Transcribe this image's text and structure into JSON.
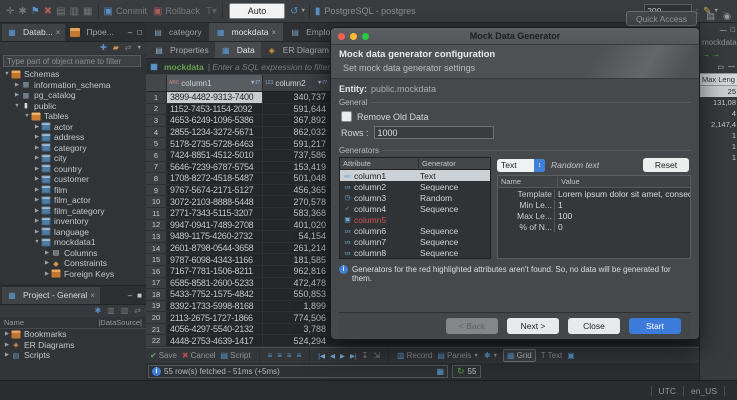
{
  "toolbar": {
    "commit": "Commit",
    "rollback": "Rollback",
    "auto": "Auto",
    "connection": "PostgreSQL - postgres",
    "fetch_size": "200",
    "quick_access": "Quick Access"
  },
  "navigator": {
    "tab_database": "Datab...",
    "tab_project_explorer": "Проe...",
    "filter_placeholder": "Type part of object name to filter",
    "tree": [
      {
        "arrow": "▼",
        "icon": "schemas",
        "label": "Schemas",
        "level": 0
      },
      {
        "arrow": "▶",
        "icon": "schema",
        "label": "information_schema",
        "level": 1
      },
      {
        "arrow": "▶",
        "icon": "schema",
        "label": "pg_catalog",
        "level": 1
      },
      {
        "arrow": "▼",
        "icon": "db",
        "label": "public",
        "level": 1
      },
      {
        "arrow": "▼",
        "icon": "tables",
        "label": "Tables",
        "level": 2
      },
      {
        "arrow": "▶",
        "icon": "table",
        "label": "actor",
        "level": 3
      },
      {
        "arrow": "▶",
        "icon": "table",
        "label": "address",
        "level": 3
      },
      {
        "arrow": "▶",
        "icon": "table",
        "label": "category",
        "level": 3
      },
      {
        "arrow": "▶",
        "icon": "table",
        "label": "city",
        "level": 3
      },
      {
        "arrow": "▶",
        "icon": "table",
        "label": "country",
        "level": 3
      },
      {
        "arrow": "▶",
        "icon": "table",
        "label": "customer",
        "level": 3
      },
      {
        "arrow": "▶",
        "icon": "table",
        "label": "film",
        "level": 3
      },
      {
        "arrow": "▶",
        "icon": "table",
        "label": "film_actor",
        "level": 3
      },
      {
        "arrow": "▶",
        "icon": "table",
        "label": "film_category",
        "level": 3
      },
      {
        "arrow": "▶",
        "icon": "table",
        "label": "inventory",
        "level": 3
      },
      {
        "arrow": "▶",
        "icon": "table",
        "label": "language",
        "level": 3
      },
      {
        "arrow": "▼",
        "icon": "table",
        "label": "mockdata1",
        "level": 3
      },
      {
        "arrow": "▶",
        "icon": "columns",
        "label": "Columns",
        "level": 4
      },
      {
        "arrow": "▶",
        "icon": "constraints",
        "label": "Constraints",
        "level": 4
      },
      {
        "arrow": "▶",
        "icon": "folder",
        "label": "Foreign Keys",
        "level": 4
      }
    ]
  },
  "project_panel": {
    "tab": "Project - General",
    "col_name": "Name",
    "col_datasource": "|DataSource|",
    "items": [
      {
        "arrow": "▶",
        "icon": "folder",
        "label": "Bookmarks"
      },
      {
        "arrow": "▶",
        "icon": "er",
        "label": "ER Diagrams"
      },
      {
        "arrow": "▶",
        "icon": "scripts",
        "label": "Scripts"
      }
    ]
  },
  "editor": {
    "tabs": [
      {
        "icon": "sql",
        "label": "category",
        "active": false,
        "closable": false
      },
      {
        "icon": "grid",
        "label": "mockdata",
        "active": true,
        "closable": true
      },
      {
        "icon": "sql",
        "label": "Employee",
        "active": false,
        "closable": false
      }
    ],
    "subtabs": [
      {
        "icon": "props",
        "label": "Properties",
        "active": false
      },
      {
        "icon": "data",
        "label": "Data",
        "active": true
      },
      {
        "icon": "er",
        "label": "ER Diagram",
        "active": false
      }
    ],
    "filter_entity": "mockdata",
    "filter_placeholder": "Enter a SQL expression to filter resu",
    "grid": {
      "col1": "column1",
      "col2": "column2",
      "col1_type": "ABC",
      "col2_type": "123",
      "rows": [
        {
          "c1": "3899-4482-9313-7400",
          "c2": "340,737",
          "sel": true
        },
        {
          "c1": "1152-7453-1154-2092",
          "c2": "591,644"
        },
        {
          "c1": "4653-6249-1096-5386",
          "c2": "367,892"
        },
        {
          "c1": "2855-1234-3272-5671",
          "c2": "862,032"
        },
        {
          "c1": "5178-2735-5728-6463",
          "c2": "591,217"
        },
        {
          "c1": "7424-8851-4512-5010",
          "c2": "737,586"
        },
        {
          "c1": "5646-7239-6787-5754",
          "c2": "153,419"
        },
        {
          "c1": "1708-8272-4518-5487",
          "c2": "501,048"
        },
        {
          "c1": "9767-5674-2171-5127",
          "c2": "456,365"
        },
        {
          "c1": "3072-2103-8888-5448",
          "c2": "270,578"
        },
        {
          "c1": "2771-7343-5115-3207",
          "c2": "583,368"
        },
        {
          "c1": "9947-0941-7489-2708",
          "c2": "401,020"
        },
        {
          "c1": "9489-1175-4260-2732",
          "c2": "54,154"
        },
        {
          "c1": "2601-8798-0544-3658",
          "c2": "261,214"
        },
        {
          "c1": "9787-6098-4343-1166",
          "c2": "181,585"
        },
        {
          "c1": "7167-7781-1506-8211",
          "c2": "962,816"
        },
        {
          "c1": "6585-8581-2600-5233",
          "c2": "472,478"
        },
        {
          "c1": "5433-7752-1575-4842",
          "c2": "550,853"
        },
        {
          "c1": "8392-1733-5998-8168",
          "c2": "1,899"
        },
        {
          "c1": "2113-2675-1727-1866",
          "c2": "774,506"
        },
        {
          "c1": "4056-4297-5540-2132",
          "c2": "3,788"
        },
        {
          "c1": "4448-2753-4639-1417",
          "c2": "524,294"
        }
      ]
    },
    "toolbar": {
      "save": "Save",
      "cancel": "Cancel",
      "script": "Script",
      "record": "Record",
      "panels": "Panels",
      "grid": "Grid",
      "text": "Text"
    },
    "status_message": "55 row(s) fetched - 51ms (+5ms)",
    "row_count": "55"
  },
  "dialog": {
    "title": "Mock Data Generator",
    "header_title": "Mock data generator configuration",
    "header_subtitle": "Set mock data generator settings",
    "entity_label": "Entity:",
    "entity_value": "public.mockdata",
    "general_label": "General",
    "remove_old_label": "Remove Old Data",
    "rows_label": "Rows :",
    "rows_value": "1000",
    "generators_label": "Generators",
    "attr_header": "Attribute",
    "gen_header": "Generator",
    "attributes": [
      {
        "name": "column1",
        "generator": "Text",
        "icon": "abc",
        "selected": true
      },
      {
        "name": "column2",
        "generator": "Sequence",
        "icon": "123"
      },
      {
        "name": "column3",
        "generator": "Random",
        "icon": "clock"
      },
      {
        "name": "column4",
        "generator": "Sequence",
        "icon": "check"
      },
      {
        "name": "column5",
        "generator": "",
        "icon": "box",
        "missing": true
      },
      {
        "name": "column6",
        "generator": "Sequence",
        "icon": "123"
      },
      {
        "name": "column7",
        "generator": "Sequence",
        "icon": "123"
      },
      {
        "name": "column8",
        "generator": "Sequence",
        "icon": "123"
      }
    ],
    "generator_select": "Text",
    "generator_desc": "Random text",
    "reset_label": "Reset",
    "prop_name_header": "Name",
    "prop_value_header": "Value",
    "props": [
      {
        "name": "Template",
        "value": "Lorem ipsum dolor sit amet, consectetur a"
      },
      {
        "name": "Min Le...",
        "value": "1"
      },
      {
        "name": "Max Le...",
        "value": "100"
      },
      {
        "name": "% of N...",
        "value": "0"
      }
    ],
    "info_message": "Generators for the red highlighted attributes aren't found. So, no data will be generated for them.",
    "buttons": {
      "back": "< Back",
      "next": "Next >",
      "close": "Close",
      "start": "Start"
    }
  },
  "side_panel": {
    "tab_label": "mockdata",
    "column_header": "Max Leng",
    "rows": [
      {
        "v": "25",
        "sel": true
      },
      {
        "v": "131,08"
      },
      {
        "v": "4"
      },
      {
        "v": "2,147,4"
      },
      {
        "v": "1"
      },
      {
        "v": "1"
      },
      {
        "v": "1"
      }
    ]
  },
  "statusbar": {
    "tz": "UTC",
    "locale": "en_US"
  }
}
